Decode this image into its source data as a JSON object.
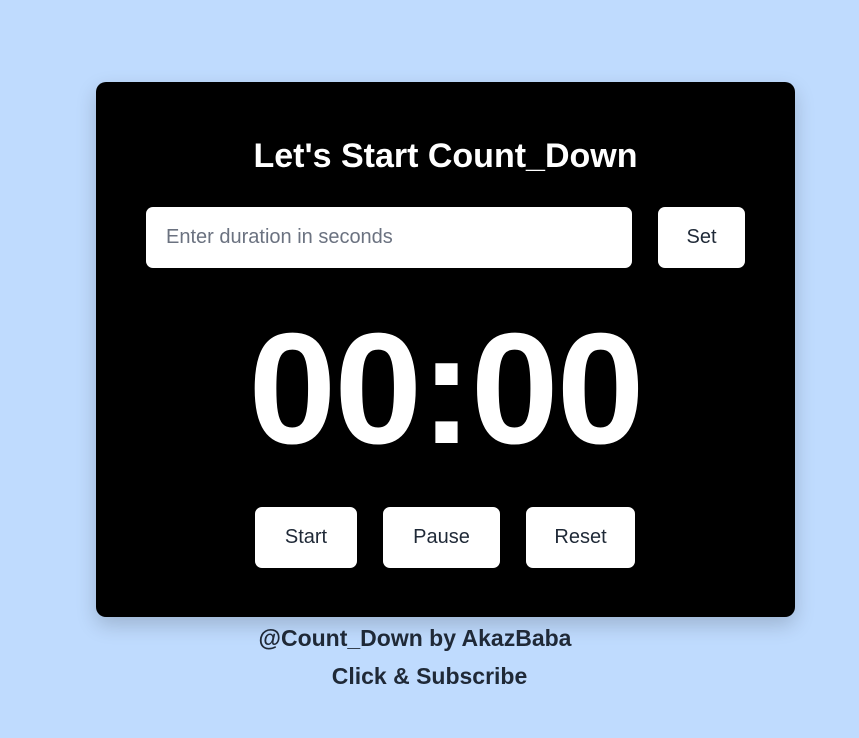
{
  "colors": {
    "background": "#bfdbfe",
    "card": "#000000",
    "button": "#ffffff",
    "text_dark": "#1f2937"
  },
  "title": "Let's Start Count_Down",
  "duration_input": {
    "placeholder": "Enter duration in seconds",
    "value": ""
  },
  "set_label": "Set",
  "timer_display": "00:00",
  "controls": {
    "start": "Start",
    "pause": "Pause",
    "reset": "Reset"
  },
  "footer": {
    "credit": "@Count_Down by AkazBaba",
    "cta": "Click & Subscribe"
  }
}
